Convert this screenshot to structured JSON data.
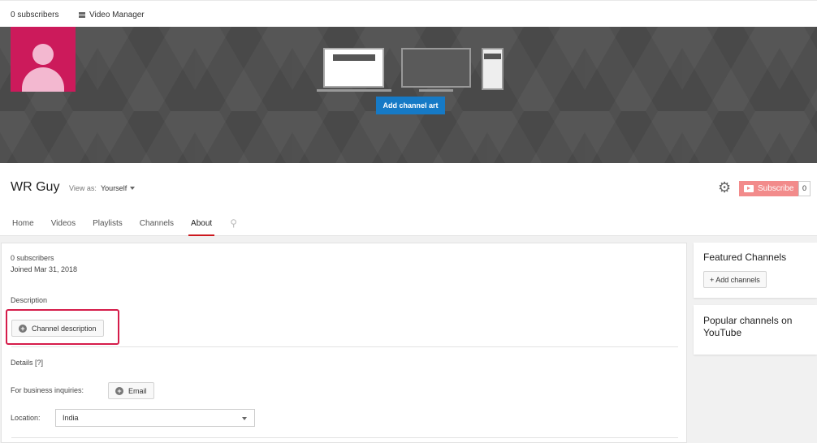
{
  "topbar": {
    "subscribers": "0 subscribers",
    "video_manager": "Video Manager",
    "video_manager_icon": "video-manager-icon"
  },
  "banner": {
    "add_channel_art": "Add channel art",
    "avatar_color": "#cc1a5b",
    "button_color": "#167ac6"
  },
  "channel": {
    "name": "WR Guy",
    "view_as_label": "View as:",
    "view_as_value": "Yourself",
    "subscribe_label": "Subscribe",
    "subscribe_count": "0",
    "settings_icon": "gear-icon",
    "subscribe_color": "#f28b8b"
  },
  "tabs": [
    {
      "label": "Home",
      "active": false
    },
    {
      "label": "Videos",
      "active": false
    },
    {
      "label": "Playlists",
      "active": false
    },
    {
      "label": "Channels",
      "active": false
    },
    {
      "label": "About",
      "active": true
    }
  ],
  "about": {
    "subscribers": "0 subscribers",
    "joined": "Joined Mar 31, 2018",
    "description_heading": "Description",
    "channel_description_button": "Channel description",
    "details_heading": "Details [?]",
    "business_label": "For business inquiries:",
    "email_button": "Email",
    "location_label": "Location:",
    "location_value": "India",
    "highlight_color": "#d51c4a"
  },
  "sidebar": {
    "featured_title": "Featured Channels",
    "add_channels": "+ Add channels",
    "popular_title": "Popular channels on YouTube"
  }
}
